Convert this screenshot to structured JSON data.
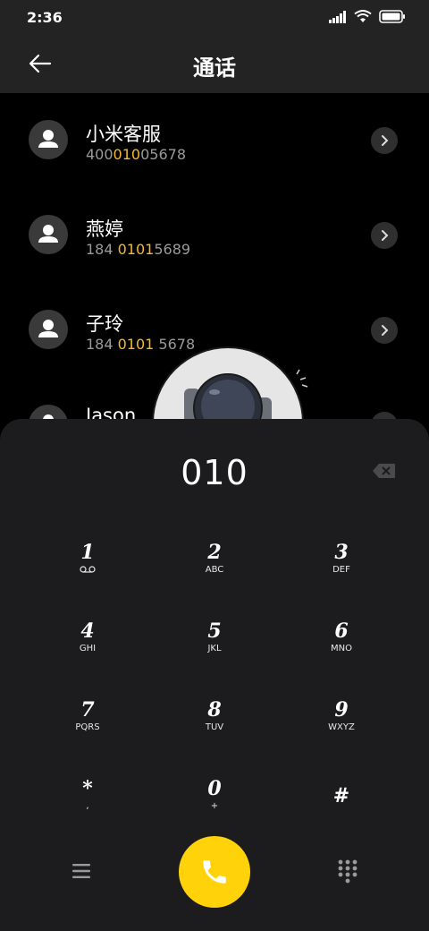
{
  "status": {
    "time": "2:36"
  },
  "header": {
    "title": "通话"
  },
  "contacts": [
    {
      "name": "小米客服",
      "num_pre": "400",
      "num_hl": "010",
      "num_post": "05678"
    },
    {
      "name": "燕婷",
      "num_pre": "184 ",
      "num_hl": "0101",
      "num_post": "5689"
    },
    {
      "name": "子玲",
      "num_pre": "184 ",
      "num_hl": "0101",
      "num_post": " 5678"
    },
    {
      "name": "Jason",
      "num_pre": "",
      "num_hl": "",
      "num_post": ""
    }
  ],
  "dialer": {
    "input": "010",
    "keys": [
      {
        "digit": "1",
        "letters": ""
      },
      {
        "digit": "2",
        "letters": "ABC"
      },
      {
        "digit": "3",
        "letters": "DEF"
      },
      {
        "digit": "4",
        "letters": "GHI"
      },
      {
        "digit": "5",
        "letters": "JKL"
      },
      {
        "digit": "6",
        "letters": "MNO"
      },
      {
        "digit": "7",
        "letters": "PQRS"
      },
      {
        "digit": "8",
        "letters": "TUV"
      },
      {
        "digit": "9",
        "letters": "WXYZ"
      },
      {
        "digit": "*",
        "letters": ","
      },
      {
        "digit": "0",
        "letters": "+"
      },
      {
        "digit": "#",
        "letters": ""
      }
    ]
  },
  "colors": {
    "accent": "#ffd20a",
    "highlight": "#f5b82e",
    "sheet": "#1c1c1e"
  },
  "icons": {
    "back": "back-arrow-icon",
    "backspace": "backspace-icon",
    "call": "phone-icon",
    "menu": "menu-icon",
    "keypad": "keypad-icon",
    "voicemail": "voicemail-icon"
  }
}
